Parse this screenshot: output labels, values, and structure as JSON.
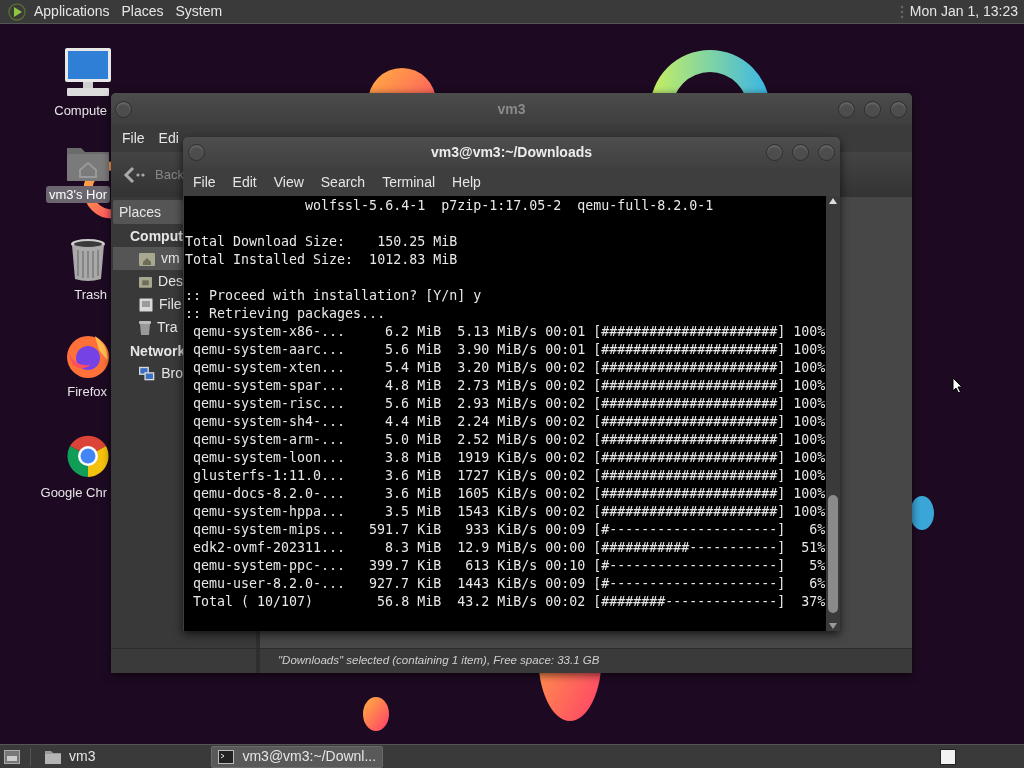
{
  "top_panel": {
    "menus": [
      "Applications",
      "Places",
      "System"
    ],
    "clock": "Mon Jan 1, 13:23"
  },
  "desktop_icons": [
    {
      "label": "Compute",
      "kind": "computer",
      "selected": false
    },
    {
      "label": "vm3's Hor",
      "kind": "home",
      "selected": true
    },
    {
      "label": "Trash",
      "kind": "trash",
      "selected": false
    },
    {
      "label": "Firefox",
      "kind": "firefox",
      "selected": false
    },
    {
      "label": "Google Chr",
      "kind": "chrome",
      "selected": false
    }
  ],
  "file_manager": {
    "title": "vm3",
    "menu": [
      "File",
      "Edi"
    ],
    "back_label": "Back",
    "sidebar": {
      "header": "Places",
      "sections": [
        {
          "title": "Comput",
          "items": [
            {
              "label": "vm",
              "kind": "home",
              "selected": true
            },
            {
              "label": "Des",
              "kind": "desktop",
              "selected": false
            },
            {
              "label": "File",
              "kind": "filesystem",
              "selected": false
            },
            {
              "label": "Tra",
              "kind": "trash",
              "selected": false
            }
          ]
        },
        {
          "title": "Network",
          "items": [
            {
              "label": "Bro",
              "kind": "network",
              "selected": false
            }
          ]
        }
      ]
    },
    "status": "\"Downloads\" selected (containing 1 item), Free space: 33.1 GB"
  },
  "terminal": {
    "title": "vm3@vm3:~/Downloads",
    "menu": [
      "File",
      "Edit",
      "View",
      "Search",
      "Terminal",
      "Help"
    ],
    "packages_line": "wolfssl-5.6.4-1  p7zip-1:17.05-2  qemu-full-8.2.0-1",
    "summary": [
      "Total Download Size:    150.25 MiB",
      "Total Installed Size:  1012.83 MiB"
    ],
    "prompt": ":: Proceed with installation? [Y/n] y",
    "status_line": ":: Retrieving packages...",
    "downloads": [
      {
        "name": "qemu-system-x86-...",
        "size": "6.2 MiB",
        "rate": "5.13 MiB/s",
        "time": "00:01",
        "bar": "[######################]",
        "percent": "100%"
      },
      {
        "name": "qemu-system-aarc...",
        "size": "5.6 MiB",
        "rate": "3.90 MiB/s",
        "time": "00:01",
        "bar": "[######################]",
        "percent": "100%"
      },
      {
        "name": "qemu-system-xten...",
        "size": "5.4 MiB",
        "rate": "3.20 MiB/s",
        "time": "00:02",
        "bar": "[######################]",
        "percent": "100%"
      },
      {
        "name": "qemu-system-spar...",
        "size": "4.8 MiB",
        "rate": "2.73 MiB/s",
        "time": "00:02",
        "bar": "[######################]",
        "percent": "100%"
      },
      {
        "name": "qemu-system-risc...",
        "size": "5.6 MiB",
        "rate": "2.93 MiB/s",
        "time": "00:02",
        "bar": "[######################]",
        "percent": "100%"
      },
      {
        "name": "qemu-system-sh4-...",
        "size": "4.4 MiB",
        "rate": "2.24 MiB/s",
        "time": "00:02",
        "bar": "[######################]",
        "percent": "100%"
      },
      {
        "name": "qemu-system-arm-...",
        "size": "5.0 MiB",
        "rate": "2.52 MiB/s",
        "time": "00:02",
        "bar": "[######################]",
        "percent": "100%"
      },
      {
        "name": "qemu-system-loon...",
        "size": "3.8 MiB",
        "rate": "1919 KiB/s",
        "time": "00:02",
        "bar": "[######################]",
        "percent": "100%"
      },
      {
        "name": "glusterfs-1:11.0...",
        "size": "3.6 MiB",
        "rate": "1727 KiB/s",
        "time": "00:02",
        "bar": "[######################]",
        "percent": "100%"
      },
      {
        "name": "qemu-docs-8.2.0-...",
        "size": "3.6 MiB",
        "rate": "1605 KiB/s",
        "time": "00:02",
        "bar": "[######################]",
        "percent": "100%"
      },
      {
        "name": "qemu-system-hppa...",
        "size": "3.5 MiB",
        "rate": "1543 KiB/s",
        "time": "00:02",
        "bar": "[######################]",
        "percent": "100%"
      },
      {
        "name": "qemu-system-mips...",
        "size": "591.7 KiB",
        "rate": "933 KiB/s",
        "time": "00:09",
        "bar": "[#---------------------]",
        "percent": "6%"
      },
      {
        "name": "edk2-ovmf-202311...",
        "size": "8.3 MiB",
        "rate": "12.9 MiB/s",
        "time": "00:00",
        "bar": "[###########-----------]",
        "percent": "51%"
      },
      {
        "name": "qemu-system-ppc-...",
        "size": "399.7 KiB",
        "rate": "613 KiB/s",
        "time": "00:10",
        "bar": "[#---------------------]",
        "percent": "5%"
      },
      {
        "name": "qemu-user-8.2.0-...",
        "size": "927.7 KiB",
        "rate": "1443 KiB/s",
        "time": "00:09",
        "bar": "[#---------------------]",
        "percent": "6%"
      },
      {
        "name": "Total ( 10/107)",
        "size": "56.8 MiB",
        "rate": "43.2 MiB/s",
        "time": "00:02",
        "bar": "[########--------------]",
        "percent": "37%"
      }
    ]
  },
  "taskbar": {
    "tasks": [
      {
        "label": "vm3",
        "kind": "folder",
        "selected": false
      },
      {
        "label": "vm3@vm3:~/Downl...",
        "kind": "terminal",
        "selected": true
      }
    ]
  }
}
